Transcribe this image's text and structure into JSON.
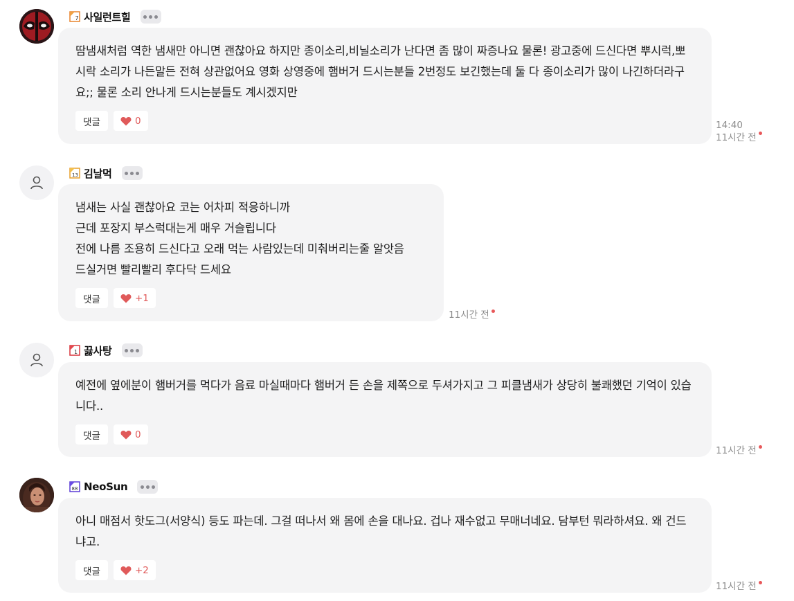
{
  "comments": [
    {
      "author": "사일런트힐",
      "text": "땀냄새처럼 역한 냄새만 아니면 괜찮아요 하지만 종이소리,비닐소리가 난다면 좀 많이 짜증나요 물론! 광고중에 드신다면 뿌시럭,뽀시락 소리가 나든말든 전혀 상관없어요 영화 상영중에 햄버거 드시는분들 2번정도 보긴했는데 둘 다 종이소리가 많이 나긴하더라구요;; 물론 소리 안나게 드시는분들도 계시겠지만",
      "reply_label": "댓글",
      "like_count": "0",
      "time_clock": "14:40",
      "time_ago": "11시간 전"
    },
    {
      "author": "김날먹",
      "text": "냄새는 사실 괜찮아요 코는 어차피 적응하니까\n근데 포장지 부스럭대는게 매우 거슬립니다\n전에 나름 조용히 드신다고 오래 먹는 사람있는데 미춰버리는줄 알앗음\n드실거면 빨리빨리 후다닥 드세요",
      "reply_label": "댓글",
      "like_count": "+1",
      "time_ago": "11시간 전"
    },
    {
      "author": "끓사탕",
      "text": "예전에 옆에분이 햄버거를 먹다가 음료 마실때마다 햄버거 든 손을 제쪽으로 두셔가지고 그 피클냄새가 상당히 불쾌했던 기억이 있습니다..",
      "reply_label": "댓글",
      "like_count": "0",
      "time_ago": "11시간 전"
    },
    {
      "author": "NeoSun",
      "text": "아니 매점서 핫도그(서양식) 등도 파는데. 그걸 떠나서 왜 몸에 손을 대나요. 겁나 재수없고 무매너네요. 담부턴 뭐라하셔요. 왜 건드냐고.",
      "reply_label": "댓글",
      "like_count": "+2",
      "time_ago": "11시간 전"
    }
  ],
  "colors": {
    "bubble": "#f4f4f5",
    "heart": "#e05a5a",
    "new_dot": "#e8585a"
  },
  "icons": [
    "deadpool-avatar",
    "default-user-icon",
    "level-badge-icon",
    "more-icon",
    "heart-icon",
    "woman-photo-avatar"
  ]
}
